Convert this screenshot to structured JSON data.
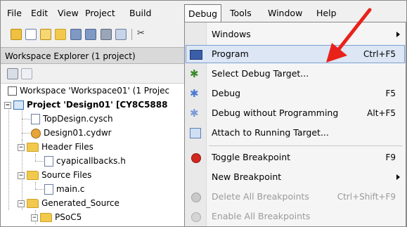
{
  "menubar": {
    "items": [
      {
        "label": "File"
      },
      {
        "label": "Edit"
      },
      {
        "label": "View"
      },
      {
        "label": "Project"
      },
      {
        "label": "Build"
      },
      {
        "label": "Debug"
      },
      {
        "label": "Tools"
      },
      {
        "label": "Window"
      },
      {
        "label": "Help"
      }
    ]
  },
  "toolbar_icons": [
    "new-project-icon",
    "new-file-icon",
    "add-item-icon",
    "open-icon",
    "save-icon",
    "save-all-icon",
    "print-icon",
    "print-preview-icon",
    "cut-icon"
  ],
  "workspace": {
    "title": "Workspace Explorer (1 project)",
    "tree": {
      "workspace": "Workspace 'Workspace01' (1 Projec",
      "project": "Project  'Design01' [CY8C5888",
      "top_design": "TopDesign.cysch",
      "cydwr": "Design01.cydwr",
      "header_files": "Header Files",
      "cyapicallbacks": "cyapicallbacks.h",
      "source_files": "Source Files",
      "main_c": "main.c",
      "generated_source": "Generated_Source",
      "psoc5": "PSoC5"
    }
  },
  "debug_menu": {
    "items": [
      {
        "label": "Windows",
        "shortcut": "",
        "submenu": true
      },
      {
        "label": "Program",
        "shortcut": "Ctrl+F5"
      },
      {
        "label": "Select Debug Target...",
        "shortcut": ""
      },
      {
        "label": "Debug",
        "shortcut": "F5"
      },
      {
        "label": "Debug without Programming",
        "shortcut": "Alt+F5"
      },
      {
        "label": "Attach to Running Target...",
        "shortcut": ""
      },
      {
        "label": "Toggle Breakpoint",
        "shortcut": "F9"
      },
      {
        "label": "New Breakpoint",
        "shortcut": "",
        "submenu": true
      },
      {
        "label": "Delete All Breakpoints",
        "shortcut": "Ctrl+Shift+F9",
        "disabled": true
      },
      {
        "label": "Enable All Breakpoints",
        "shortcut": "",
        "disabled": true
      }
    ]
  },
  "colors": {
    "highlight": "#dce6f4",
    "highlight_border": "#7aa1d2",
    "arrow": "#e8221b"
  }
}
